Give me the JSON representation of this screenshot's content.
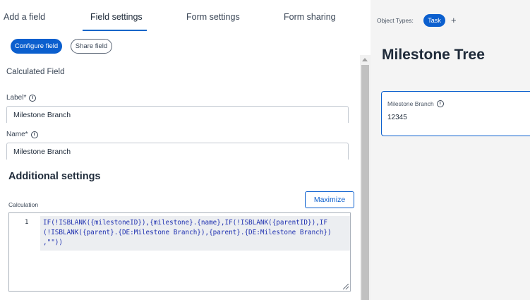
{
  "tabs": [
    {
      "label": "Add a field"
    },
    {
      "label": "Field settings",
      "active": true
    },
    {
      "label": "Form settings"
    },
    {
      "label": "Form sharing"
    }
  ],
  "actions": {
    "configure_label": "Configure field",
    "share_label": "Share field"
  },
  "field": {
    "type_title": "Calculated Field",
    "label_label": "Label*",
    "label_value": "Milestone Branch",
    "name_label": "Name*",
    "name_value": "Milestone Branch",
    "info_glyph": "i"
  },
  "additional": {
    "heading": "Additional settings",
    "calculation_label": "Calculation",
    "maximize_label": "Maximize",
    "line_number": "1",
    "code": "IF(!ISBLANK({milestoneID}),{milestone}.{name},IF(!ISBLANK({parentID}),IF\n(!ISBLANK({parent}.{DE:Milestone Branch}),{parent}.{DE:Milestone Branch})\n,\"\"))"
  },
  "preview": {
    "object_types_label": "Object Types:",
    "object_type": "Task",
    "add_symbol": "+",
    "form_title": "Milestone Tree",
    "field_label": "Milestone Branch",
    "field_value": "12345"
  },
  "colors": {
    "accent": "#0b5fce",
    "code_text": "#1d2fb0",
    "right_panel_bg": "#f4f4f4"
  },
  "icons": {
    "info": "info-circle-icon",
    "add": "plus-icon",
    "scroll_up": "scroll-up-arrow-icon",
    "resize": "resize-grip-icon"
  }
}
